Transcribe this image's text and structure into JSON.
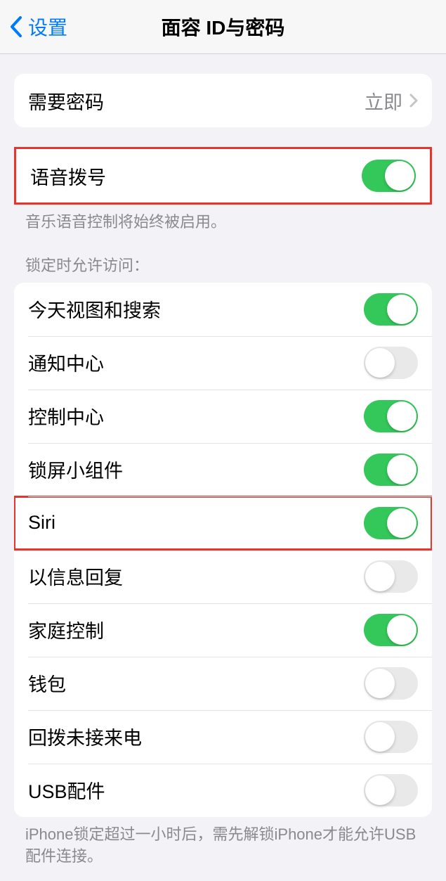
{
  "nav": {
    "back_label": "设置",
    "title": "面容 ID与密码"
  },
  "passcode_row": {
    "label": "需要密码",
    "value": "立即"
  },
  "voice_dial": {
    "label": "语音拨号",
    "footer": "音乐语音控制将始终被启用。"
  },
  "locked_access": {
    "header": "锁定时允许访问：",
    "items": [
      {
        "label": "今天视图和搜索",
        "on": true
      },
      {
        "label": "通知中心",
        "on": false
      },
      {
        "label": "控制中心",
        "on": true
      },
      {
        "label": "锁屏小组件",
        "on": true
      },
      {
        "label": "Siri",
        "on": true
      },
      {
        "label": "以信息回复",
        "on": false
      },
      {
        "label": "家庭控制",
        "on": true
      },
      {
        "label": "钱包",
        "on": false
      },
      {
        "label": "回拨未接来电",
        "on": false
      },
      {
        "label": "USB配件",
        "on": false
      }
    ],
    "footer": "iPhone锁定超过一小时后，需先解锁iPhone才能允许USB 配件连接。"
  }
}
